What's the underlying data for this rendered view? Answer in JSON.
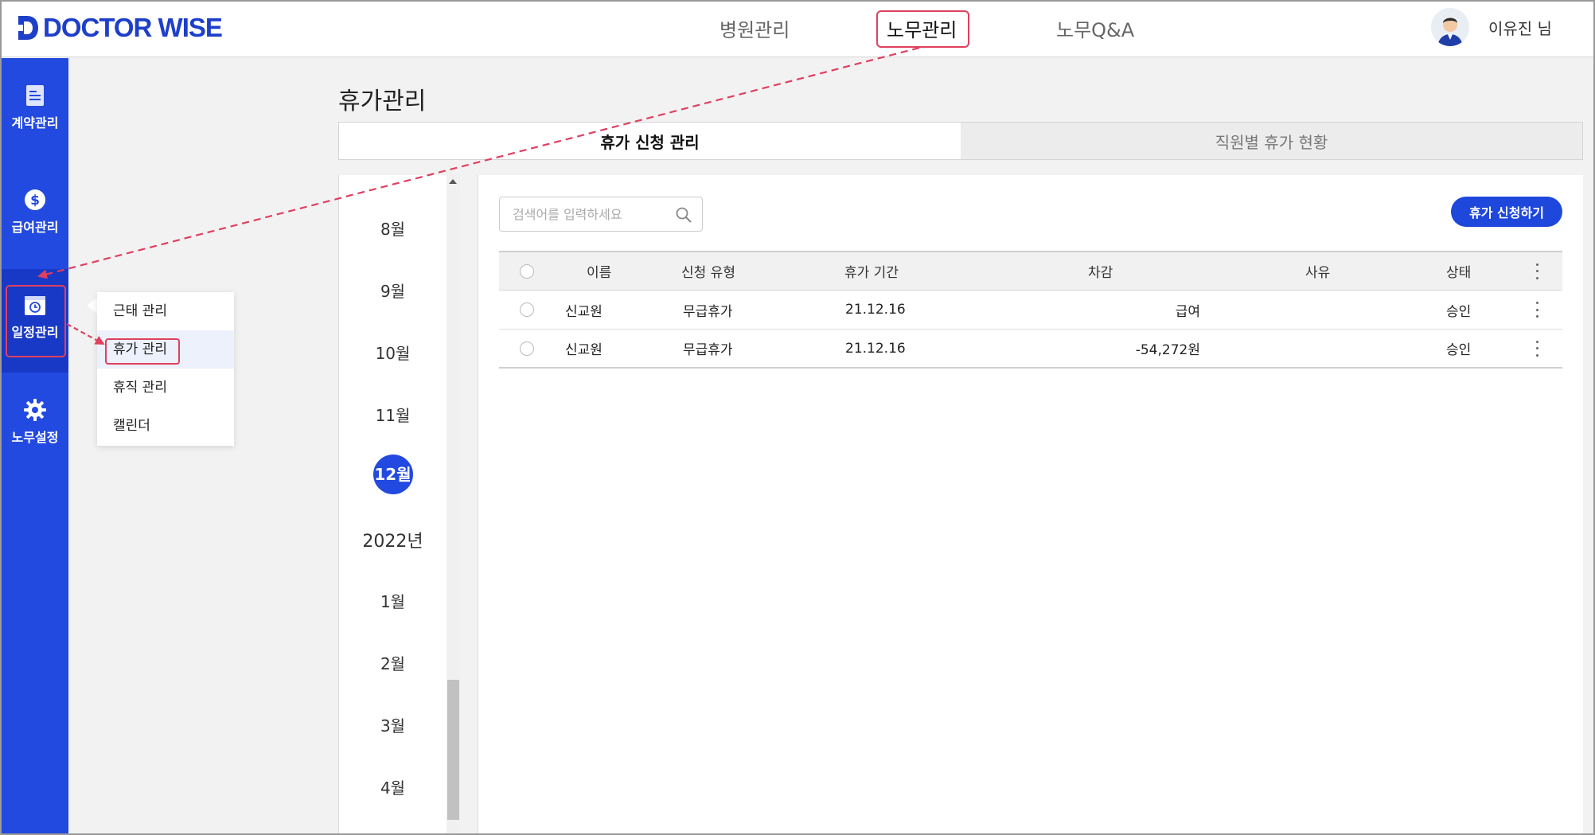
{
  "header": {
    "logo_text": "DOCTOR WISE",
    "nav": [
      {
        "label": "병원관리"
      },
      {
        "label": "노무관리"
      },
      {
        "label": "노무Q&A"
      }
    ],
    "user_name": "이유진 님"
  },
  "sidebar": {
    "items": [
      {
        "label": "계약관리",
        "icon": "document-icon"
      },
      {
        "label": "급여관리",
        "icon": "dollar-coin-icon"
      },
      {
        "label": "일정관리",
        "icon": "calendar-clock-icon"
      },
      {
        "label": "노무설정",
        "icon": "gear-icon"
      }
    ]
  },
  "submenu": {
    "items": [
      {
        "label": "근태 관리"
      },
      {
        "label": "휴가 관리"
      },
      {
        "label": "휴직 관리"
      },
      {
        "label": "캘린더"
      }
    ]
  },
  "page": {
    "title": "휴가관리",
    "tabs": [
      {
        "label": "휴가 신청 관리"
      },
      {
        "label": "직원별 휴가 현황"
      }
    ]
  },
  "months": {
    "items": [
      "8월",
      "9월",
      "10월",
      "11월",
      "12월",
      "2022년",
      "1월",
      "2월",
      "3월",
      "4월"
    ],
    "selected": "12월"
  },
  "search": {
    "placeholder": "검색어를 입력하세요"
  },
  "actions": {
    "apply_label": "휴가 신청하기"
  },
  "table": {
    "headers": [
      "이름",
      "신청 유형",
      "휴가 기간",
      "차감",
      "사유",
      "상태"
    ],
    "rows": [
      {
        "name": "신교원",
        "type": "무급휴가",
        "period": "21.12.16",
        "deduction": "급여",
        "reason": "",
        "status": "승인"
      },
      {
        "name": "신교원",
        "type": "무급휴가",
        "period": "21.12.16",
        "deduction": "-54,272원",
        "reason": "",
        "status": "승인"
      }
    ]
  },
  "colors": {
    "brand": "#1d3fc9",
    "sidebar": "#2249e0",
    "highlight": "#e0405e"
  }
}
